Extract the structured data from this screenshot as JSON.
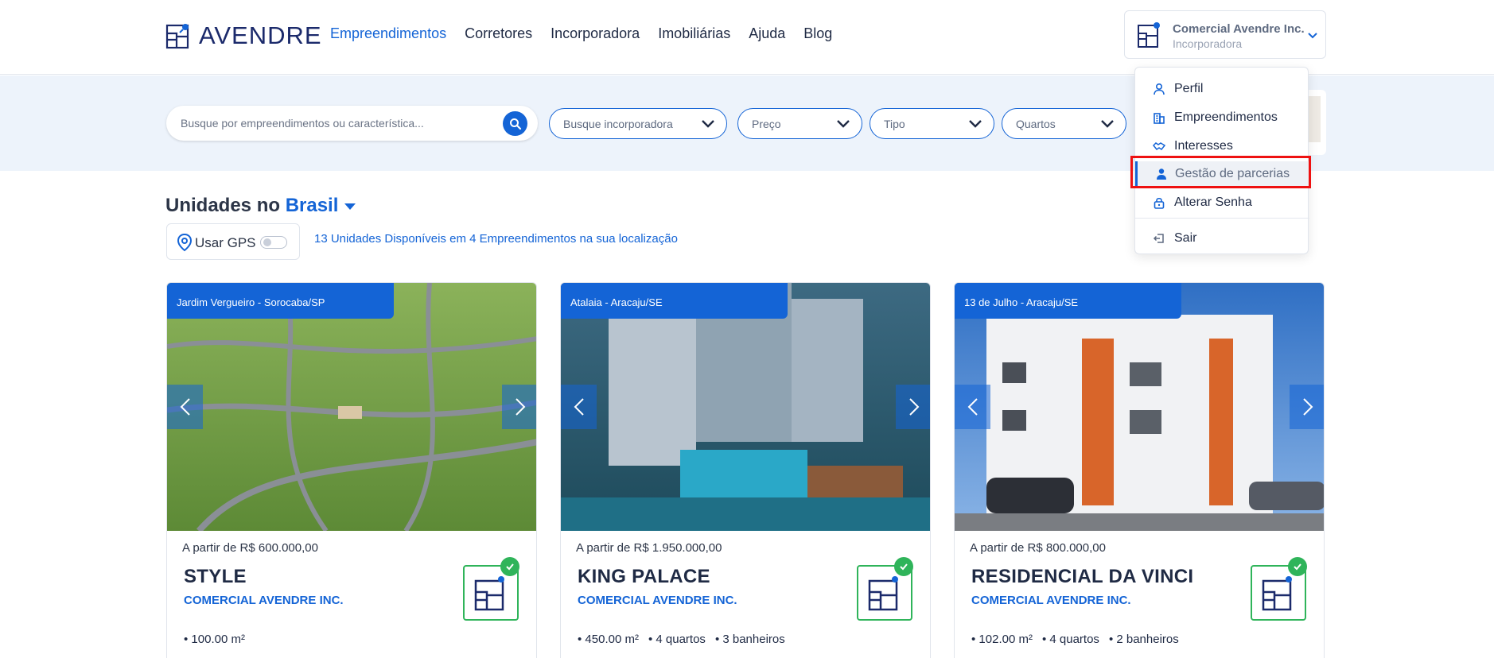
{
  "header": {
    "logo_text": "AVENDRE",
    "nav": [
      {
        "label": "Empreendimentos",
        "active": true
      },
      {
        "label": "Corretores",
        "active": false
      },
      {
        "label": "Incorporadora",
        "active": false
      },
      {
        "label": "Imobiliárias",
        "active": false
      },
      {
        "label": "Ajuda",
        "active": false
      },
      {
        "label": "Blog",
        "active": false
      }
    ],
    "account": {
      "name": "Comercial Avendre Inc.",
      "role": "Incorporadora"
    }
  },
  "search": {
    "placeholder": "Busque por empreendimentos ou característica...",
    "filters": [
      {
        "placeholder": "Busque incorporadora"
      },
      {
        "placeholder": "Preço"
      },
      {
        "placeholder": "Tipo"
      },
      {
        "placeholder": "Quartos"
      }
    ]
  },
  "section": {
    "title_prefix": "Unidades no",
    "location": "Brasil",
    "gps_label": "Usar GPS",
    "gps_enabled": false,
    "units_summary": "13 Unidades Disponíveis em 4 Empreendimentos na sua localização"
  },
  "cards": [
    {
      "location": "Jardim Vergueiro - Sorocaba/SP",
      "price": "A partir de R$ 600.000,00",
      "name": "STYLE",
      "company": "COMERCIAL AVENDRE INC.",
      "area": "100.00 m²",
      "specs": []
    },
    {
      "location": "Atalaia - Aracaju/SE",
      "price": "A partir de R$ 1.950.000,00",
      "name": "KING PALACE",
      "company": "COMERCIAL AVENDRE INC.",
      "area": "450.00 m²",
      "specs": [
        "4 quartos",
        "3 banheiros"
      ]
    },
    {
      "location": "13 de Julho - Aracaju/SE",
      "price": "A partir de R$ 800.000,00",
      "name": "RESIDENCIAL DA VINCI",
      "company": "COMERCIAL AVENDRE INC.",
      "area": "102.00 m²",
      "specs": [
        "4 quartos",
        "2 banheiros"
      ]
    }
  ],
  "menu": {
    "items": [
      {
        "label": "Perfil",
        "icon": "user-icon"
      },
      {
        "label": "Empreendimentos",
        "icon": "building-icon"
      },
      {
        "label": "Interesses",
        "icon": "handshake-icon"
      },
      {
        "label": "Gestão de parcerias",
        "icon": "partner-user-icon",
        "highlighted": true
      },
      {
        "label": "Alterar Senha",
        "icon": "lock-icon"
      },
      {
        "label": "Sair",
        "icon": "logout-icon"
      }
    ]
  },
  "colors": {
    "primary": "#1464d6",
    "success": "#2fb45a",
    "highlight_border": "#ee1111",
    "band": "#edf3fb"
  }
}
